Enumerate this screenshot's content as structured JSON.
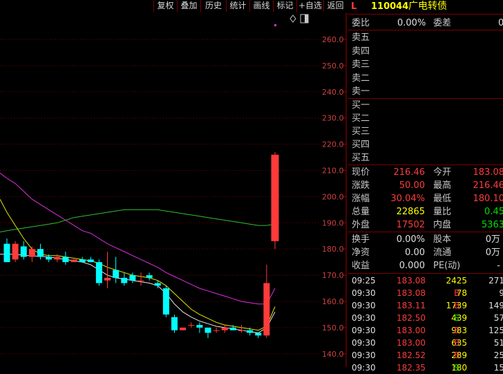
{
  "toolbar": {
    "buttons": [
      "复权",
      "叠加",
      "历史",
      "统计",
      "画线",
      "标记",
      "+自选",
      "返回"
    ]
  },
  "chart": {
    "y_labels": [
      "260.0",
      "250.0",
      "240.0",
      "230.0",
      "220.0",
      "210.0",
      "200.0",
      "190.0",
      "180.0",
      "170.0",
      "160.0",
      "150.0",
      "140.0"
    ]
  },
  "chart_data": {
    "type": "candlestick",
    "ylim": [
      136,
      268
    ],
    "candles": [
      {
        "o": 182,
        "h": 184,
        "l": 175,
        "c": 175
      },
      {
        "o": 176,
        "h": 183,
        "l": 175,
        "c": 182
      },
      {
        "o": 181,
        "h": 183,
        "l": 176,
        "c": 177
      },
      {
        "o": 177,
        "h": 181,
        "l": 175,
        "c": 180
      },
      {
        "o": 180,
        "h": 182,
        "l": 176,
        "c": 177
      },
      {
        "o": 177,
        "h": 178,
        "l": 175,
        "c": 176
      },
      {
        "o": 176,
        "h": 178,
        "l": 175,
        "c": 177
      },
      {
        "o": 177,
        "h": 179,
        "l": 174,
        "c": 175
      },
      {
        "o": 175,
        "h": 176,
        "l": 175,
        "c": 176
      },
      {
        "o": 176,
        "h": 177,
        "l": 175,
        "c": 175
      },
      {
        "o": 176,
        "h": 177,
        "l": 175,
        "c": 175
      },
      {
        "o": 175,
        "h": 176,
        "l": 166,
        "c": 167
      },
      {
        "o": 168,
        "h": 179,
        "l": 165,
        "c": 169
      },
      {
        "o": 172,
        "h": 177,
        "l": 167,
        "c": 169
      },
      {
        "o": 169,
        "h": 171,
        "l": 166,
        "c": 167
      },
      {
        "o": 170,
        "h": 171,
        "l": 167,
        "c": 168
      },
      {
        "o": 168,
        "h": 171,
        "l": 166,
        "c": 168
      },
      {
        "o": 170,
        "h": 171,
        "l": 168,
        "c": 169
      },
      {
        "o": 167,
        "h": 168,
        "l": 165,
        "c": 166
      },
      {
        "o": 165,
        "h": 166,
        "l": 154,
        "c": 155
      },
      {
        "o": 154,
        "h": 155,
        "l": 148,
        "c": 149
      },
      {
        "o": 149,
        "h": 150,
        "l": 149,
        "c": 150
      },
      {
        "o": 151,
        "h": 152,
        "l": 150,
        "c": 151
      },
      {
        "o": 151,
        "h": 152,
        "l": 148,
        "c": 150
      },
      {
        "o": 150,
        "h": 150,
        "l": 146,
        "c": 148
      },
      {
        "o": 149,
        "h": 150,
        "l": 148,
        "c": 149
      },
      {
        "o": 149,
        "h": 151,
        "l": 148,
        "c": 150
      },
      {
        "o": 150,
        "h": 151,
        "l": 149,
        "c": 149
      },
      {
        "o": 149,
        "h": 151,
        "l": 148,
        "c": 149
      },
      {
        "o": 149,
        "h": 150,
        "l": 147,
        "c": 148
      },
      {
        "o": 148,
        "h": 148,
        "l": 146,
        "c": 147
      },
      {
        "o": 147,
        "h": 174,
        "l": 146,
        "c": 167
      },
      {
        "o": 183,
        "h": 217,
        "l": 180,
        "c": 216
      }
    ],
    "ma_white": [
      178,
      178,
      177.6,
      177.4,
      177.2,
      177,
      176.5,
      176,
      175.5,
      175,
      174,
      172,
      170,
      169,
      168.5,
      168,
      167.5,
      167,
      166,
      163,
      159,
      156,
      154,
      152.5,
      151.5,
      150.5,
      150,
      149.5,
      149,
      148.5,
      148,
      150,
      156
    ],
    "ma_yellow": [
      194,
      189,
      184,
      180,
      178,
      177.5,
      177.5,
      177,
      176.5,
      176,
      175.5,
      174.5,
      173,
      172,
      171,
      170,
      169.5,
      169,
      168,
      166,
      163,
      160,
      157,
      155,
      153.5,
      152,
      151,
      150.5,
      150,
      149.5,
      149,
      150.5,
      158
    ],
    "ma_magenta": [
      207,
      205,
      202,
      199,
      197,
      195,
      193,
      191,
      189,
      187,
      186,
      184,
      182,
      180.5,
      179,
      177.5,
      176,
      174.5,
      173,
      171,
      169.5,
      168,
      166.5,
      165,
      164,
      163,
      162,
      161,
      160,
      159.5,
      159,
      159,
      165
    ],
    "ma_green": [
      187,
      187.5,
      188,
      188.5,
      189,
      189.5,
      190,
      191,
      192,
      192.5,
      193,
      193.5,
      194,
      194.5,
      195,
      195,
      195,
      195,
      195,
      194.5,
      194,
      193.5,
      193,
      192.5,
      192,
      191.5,
      191,
      190.5,
      190,
      189.5,
      189,
      189,
      189.5
    ]
  },
  "quote": {
    "header_prefix": "L",
    "code": "110044",
    "name": "广电转债",
    "weibi_label": "委比",
    "weibi": "0.00%",
    "weicha_label": "委差",
    "weicha": "0",
    "sell": [
      "卖五",
      "卖四",
      "卖三",
      "卖二",
      "卖一"
    ],
    "buy": [
      "买一",
      "买二",
      "买三",
      "买四",
      "买五"
    ],
    "stats": [
      {
        "l1": "现价",
        "v1": "216.46",
        "l2": "今开",
        "v2": "183.08"
      },
      {
        "l1": "涨跌",
        "v1": "50.00",
        "l2": "最高",
        "v2": "216.46"
      },
      {
        "l1": "涨幅",
        "v1": "30.04%",
        "l2": "最低",
        "v2": "180.10"
      },
      {
        "l1": "总量",
        "v1": "22865",
        "l2": "量比",
        "v2": "0.45"
      },
      {
        "l1": "外盘",
        "v1": "17502",
        "l2": "内盘",
        "v2": "5363"
      }
    ],
    "extra": [
      {
        "l1": "换手",
        "v1": "0.00%",
        "l2": "股本",
        "v2": "0万"
      },
      {
        "l1": "净资",
        "v1": "0.00",
        "l2": "流通",
        "v2": "0万"
      },
      {
        "l1": "收益",
        "v1": "0.000",
        "l2": "PE(动)",
        "v2": "-"
      }
    ],
    "trades": [
      {
        "time": "09:25",
        "price": "183.08",
        "vol": "2425",
        "bs": "",
        "num": "271"
      },
      {
        "time": "09:30",
        "price": "183.08",
        "vol": "78",
        "bs": "B",
        "num": "9"
      },
      {
        "time": "09:30",
        "price": "183.11",
        "vol": "1739",
        "bs": "B",
        "num": "149"
      },
      {
        "time": "09:30",
        "price": "182.50",
        "vol": "439",
        "bs": "S",
        "num": "57"
      },
      {
        "time": "09:30",
        "price": "183.00",
        "vol": "983",
        "bs": "B",
        "num": "125"
      },
      {
        "time": "09:30",
        "price": "183.00",
        "vol": "635",
        "bs": "B",
        "num": "51"
      },
      {
        "time": "09:30",
        "price": "182.52",
        "vol": "289",
        "bs": "B",
        "num": "25"
      },
      {
        "time": "09:30",
        "price": "182.35",
        "vol": "180",
        "bs": "S",
        "num": "15"
      }
    ]
  },
  "colors": {
    "up": "#ff3b3b",
    "down": "#00ffff",
    "ma_white": "#e8e8e8",
    "ma_yellow": "#e8e800",
    "ma_magenta": "#e030e0",
    "ma_green": "#30c030"
  }
}
